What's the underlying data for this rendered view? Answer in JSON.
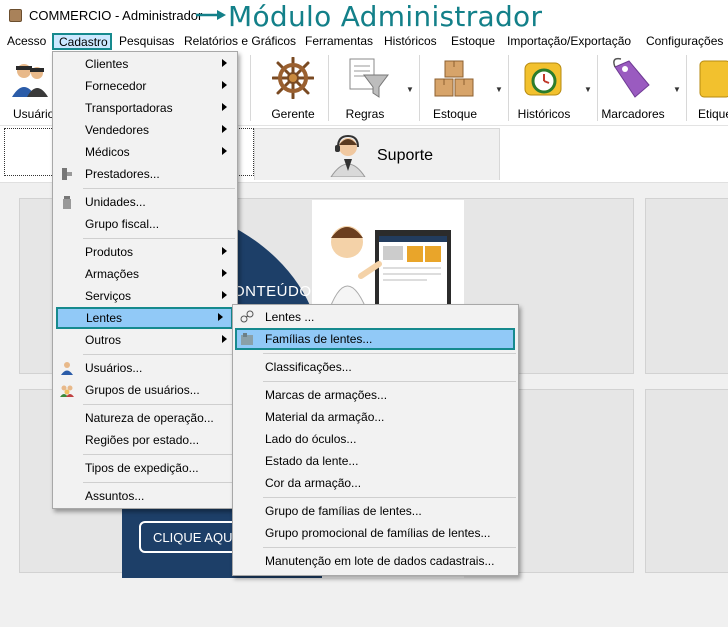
{
  "window": {
    "title": "COMMERCIO - Administrador",
    "annotation": "Módulo Administrador",
    "accent": "#168a8e"
  },
  "menubar": {
    "items": [
      "Acesso",
      "Cadastro",
      "Pesquisas",
      "Relatórios e Gráficos",
      "Ferramentas",
      "Históricos",
      "Estoque",
      "Importação/Exportação",
      "Configurações"
    ]
  },
  "toolbar": {
    "buttons": [
      {
        "label": "Usuários",
        "icon": "users-icon"
      },
      {
        "label": "Gerente",
        "icon": "ship-wheel-icon"
      },
      {
        "label": "Regras",
        "icon": "funnel-rules-icon"
      },
      {
        "label": "Estoque",
        "icon": "boxes-icon"
      },
      {
        "label": "Históricos",
        "icon": "clock-history-icon"
      },
      {
        "label": "Marcadores",
        "icon": "tag-icon"
      },
      {
        "label": "Etique",
        "icon": "label-icon"
      }
    ]
  },
  "tabs": {
    "suporte": "Suporte"
  },
  "banner": {
    "heading": "ONTEÚDO",
    "cta": "CLIQUE AQUI PA"
  },
  "cadastro_menu": {
    "items": [
      {
        "label": "Clientes",
        "submenu": true
      },
      {
        "label": "Fornecedor",
        "submenu": true
      },
      {
        "label": "Transportadoras",
        "submenu": true
      },
      {
        "label": "Vendedores",
        "submenu": true
      },
      {
        "label": "Médicos",
        "submenu": true
      },
      {
        "label": "Prestadores...",
        "submenu": false
      },
      {
        "label": "Unidades...",
        "submenu": false
      },
      {
        "label": "Grupo fiscal...",
        "submenu": false
      },
      {
        "label": "Produtos",
        "submenu": true
      },
      {
        "label": "Armações",
        "submenu": true
      },
      {
        "label": "Serviços",
        "submenu": true
      },
      {
        "label": "Lentes",
        "submenu": true
      },
      {
        "label": "Outros",
        "submenu": true
      },
      {
        "label": "Usuários...",
        "submenu": false
      },
      {
        "label": "Grupos de usuários...",
        "submenu": false
      },
      {
        "label": "Natureza de operação...",
        "submenu": false
      },
      {
        "label": "Regiões por estado...",
        "submenu": false
      },
      {
        "label": "Tipos de expedição...",
        "submenu": false
      },
      {
        "label": "Assuntos...",
        "submenu": false
      }
    ]
  },
  "lentes_menu": {
    "items": [
      {
        "label": "Lentes ..."
      },
      {
        "label": "Famílias de lentes..."
      },
      {
        "label": "Classificações..."
      },
      {
        "label": "Marcas de armações..."
      },
      {
        "label": "Material da armação..."
      },
      {
        "label": "Lado do óculos..."
      },
      {
        "label": "Estado da lente..."
      },
      {
        "label": "Cor da armação..."
      },
      {
        "label": "Grupo de famílias de lentes..."
      },
      {
        "label": "Grupo promocional de famílias de lentes..."
      },
      {
        "label": "Manutenção em lote de dados cadastrais..."
      }
    ]
  }
}
